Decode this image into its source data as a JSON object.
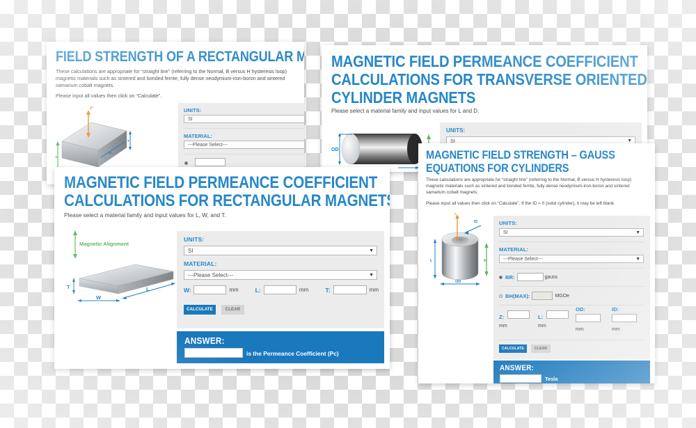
{
  "cards": {
    "rect_field_strength": {
      "title": "FIELD STRENGTH OF A RECTANGULAR MAGNET",
      "paragraph": "These calculations are appropriate for “straight line” (referring to the Normal, B versus H hysteresis loop) magnetic materials such as sintered and bonded ferrite, fully dense neodymium-iron-boron and sintered samarium cobalt magnets.",
      "instruction": "Please input all values then click on “Calculate”.",
      "units_label": "UNITS:",
      "units_value": "SI",
      "material_label": "MATERIAL:",
      "material_value": "---Please Select---",
      "diagram": {
        "z_label": "Z*",
        "t_label": "T",
        "d_label": "D",
        "m_label": "M"
      }
    },
    "transverse_cylinder": {
      "title_line1": "MAGNETIC FIELD PERMEANCE COEFFICIENT",
      "title_line2": "CALCULATIONS FOR TRANSVERSE ORIENTED",
      "title_line3": "CYLINDER MAGNETS",
      "instruction": "Please select a material family and input values for L and D.",
      "units_label": "UNITS:",
      "units_value": "SI",
      "diagram": {
        "od_label": "OD"
      }
    },
    "rect_permeance": {
      "title_line1": "MAGNETIC FIELD PERMEANCE COEFFICIENT",
      "title_line2": "CALCULATIONS FOR RECTANGULAR MAGNETS",
      "instruction": "Please select a material family and input values for L, W, and T.",
      "units_label": "UNITS:",
      "units_value": "SI",
      "material_label": "MATERIAL:",
      "material_value": "---Please Select---",
      "fields": [
        {
          "label": "W:",
          "value": "",
          "unit": "mm"
        },
        {
          "label": "L:",
          "value": "",
          "unit": "mm"
        },
        {
          "label": "T:",
          "value": "",
          "unit": "mm"
        }
      ],
      "calculate_label": "CALCULATE",
      "clear_label": "CLEAR",
      "answer_title": "ANSWER:",
      "answer_value": "",
      "answer_unit": "is the Permeance Coefficient (Pc)",
      "diagram": {
        "alignment_label": "Magnetic Alignment",
        "t_label": "T",
        "w_label": "W",
        "l_label": "L"
      }
    },
    "gauss_cylinder": {
      "title_line1": "MAGNETIC FIELD STRENGTH – GAUSS",
      "title_line2": "EQUATIONS FOR CYLINDERS",
      "paragraph": "These calculations are appropriate for “straight line” (referring to the Normal, B versus H hysteresis loop) magnetic materials such as sintered and bonded ferrite, fully dense neodymium-iron-boron and sintered samarium cobalt magnets.",
      "instruction": "Please input all values then click on “Calculate”. If the ID = 0 (solid cylinder), it may be left blank.",
      "units_label": "UNITS:",
      "units_value": "SI",
      "material_label": "MATERIAL:",
      "material_value": "---Please Select---",
      "br_label": "BR:",
      "br_value": "",
      "br_unit": "gauss",
      "bhmax_label": "BH(MAX):",
      "bhmax_value": "",
      "bhmax_unit": "MGOe",
      "fields": [
        {
          "label": "Z:",
          "value": "",
          "unit": "mm"
        },
        {
          "label": "L:",
          "value": "",
          "unit": "mm"
        },
        {
          "label": "OD:",
          "value": "",
          "unit": "mm"
        },
        {
          "label": "ID:",
          "value": "",
          "unit": "mm"
        }
      ],
      "calculate_label": "CALCULATE",
      "clear_label": "CLEAR",
      "answer_title": "ANSWER:",
      "answer_value": "",
      "answer_unit": "Tesla",
      "diagram": {
        "z_label": "Z",
        "id_label": "ID",
        "l_label": "L",
        "m_label": "M",
        "od_label": "OD"
      }
    }
  },
  "colors": {
    "brand_blue": "#2787c8",
    "panel_blue": "#1a78bd",
    "panel_grey": "#ececec",
    "green": "#5cb85c",
    "orange": "#e8902a"
  }
}
